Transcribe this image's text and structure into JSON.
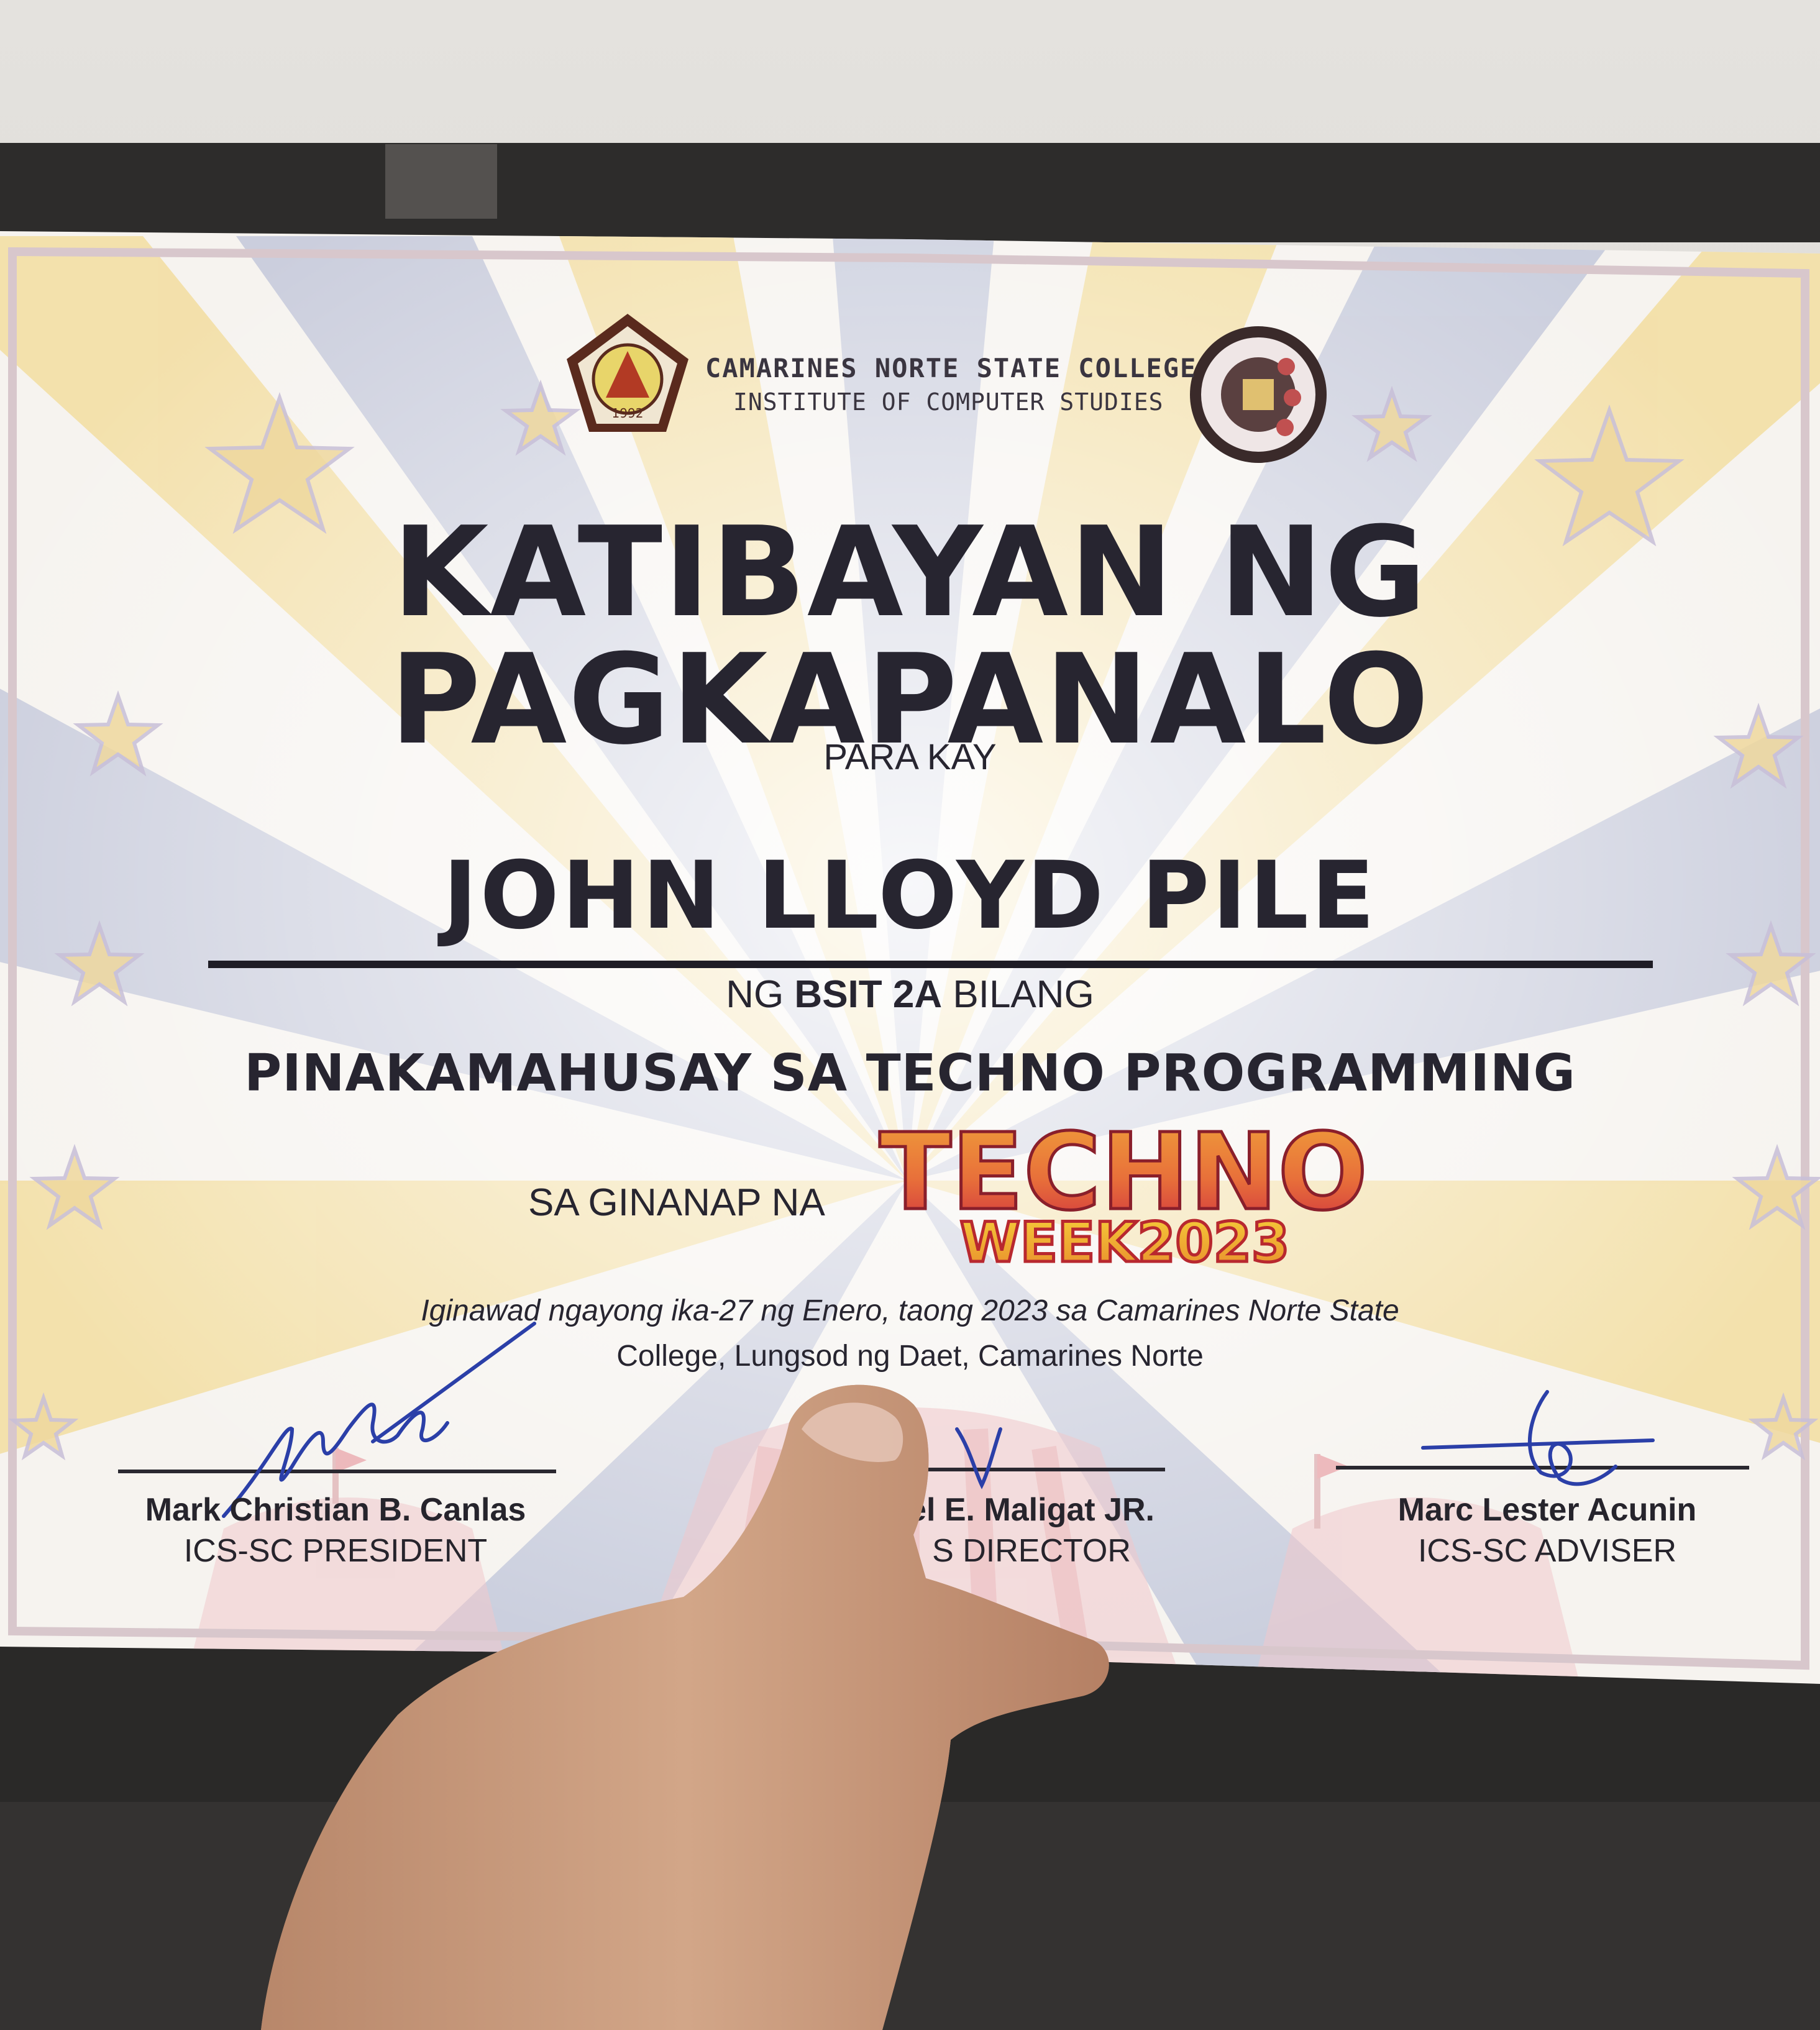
{
  "certificate": {
    "college": "CAMARINES NORTE STATE COLLEGE",
    "institute": "INSTITUTE OF COMPUTER STUDIES",
    "title_line1": "KATIBAYAN NG",
    "title_line2": "PAGKAPANALO",
    "para_kay": "PARA KAY",
    "recipient": "JOHN LLOYD PILE",
    "ng": "NG",
    "section": "BSIT 2A",
    "bilang": "BILANG",
    "award": "PINAKAMAHUSAY SA TECHNO PROGRAMMING",
    "ginanap": "SA GINANAP NA",
    "event_top": "TECHNO",
    "event_bottom": "WEEK2023",
    "given_line1": "Iginawad ngayong ika-27 ng Enero, taong 2023 sa Camarines Norte State",
    "given_line2": "College, Lungsod ng Daet, Camarines Norte",
    "seal_year": "1992",
    "seal_text": "CAMARINES NORTE STATE COLLEGE",
    "ics_seal_text": "INSTITUTE OF COMPUTER STUDIES"
  },
  "signatories": [
    {
      "name": "Mark Christian B. Canlas",
      "role": "ICS-SC PRESIDENT"
    },
    {
      "name": "el E. Maligat JR.",
      "role": "S DIRECTOR"
    },
    {
      "name": "Marc Lester Acunin",
      "role": "ICS-SC ADVISER"
    }
  ],
  "colors": {
    "paper": "#f6f3ef",
    "stripe_yellow": "#f3dfa4",
    "stripe_blue": "#c7cbdc",
    "ink": "#272530",
    "border": "#d8c7cc",
    "techno_orange": "#e8703a",
    "techno_red": "#d6383c",
    "techno_yellow": "#f2b233",
    "skin": "#c99a7c",
    "background_dark": "#2b2a29"
  },
  "icons": [
    "college-seal-icon",
    "ics-seal-icon",
    "star-icon",
    "signature-icon",
    "hand-photo"
  ]
}
